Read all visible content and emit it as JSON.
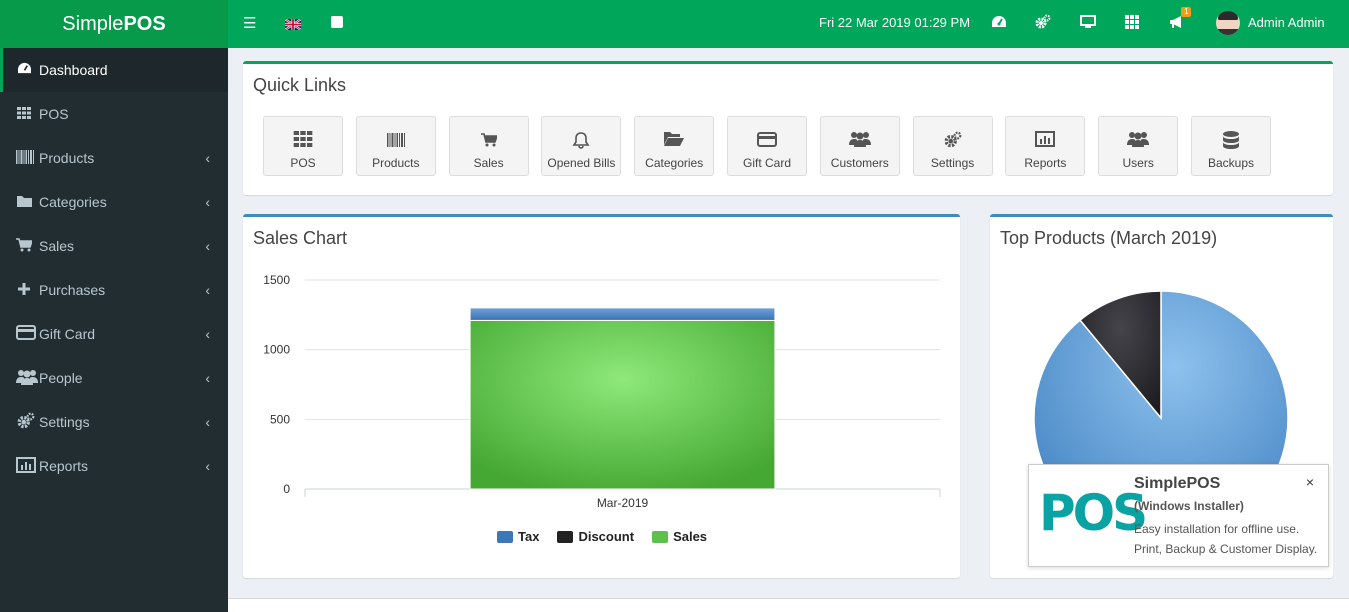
{
  "header": {
    "logo_light": "Simple",
    "logo_bold": "POS",
    "datetime": "Fri 22 Mar 2019 01:29 PM",
    "notification_count": "1",
    "user_name": "Admin Admin"
  },
  "sidebar": {
    "items": [
      {
        "label": "Dashboard",
        "icon": "dashboard-icon"
      },
      {
        "label": "POS",
        "icon": "grid-icon"
      },
      {
        "label": "Products",
        "icon": "barcode-icon"
      },
      {
        "label": "Categories",
        "icon": "folder-icon"
      },
      {
        "label": "Sales",
        "icon": "cart-icon"
      },
      {
        "label": "Purchases",
        "icon": "plus-icon"
      },
      {
        "label": "Gift Card",
        "icon": "credit-card-icon"
      },
      {
        "label": "People",
        "icon": "users-icon"
      },
      {
        "label": "Settings",
        "icon": "gears-icon"
      },
      {
        "label": "Reports",
        "icon": "bar-chart-icon"
      }
    ]
  },
  "quick_links": {
    "title": "Quick Links",
    "items": [
      {
        "label": "POS",
        "icon": "th-icon"
      },
      {
        "label": "Products",
        "icon": "barcode-icon"
      },
      {
        "label": "Sales",
        "icon": "cart-icon"
      },
      {
        "label": "Opened Bills",
        "icon": "bell-icon"
      },
      {
        "label": "Categories",
        "icon": "folder-open-icon"
      },
      {
        "label": "Gift Card",
        "icon": "credit-card-icon"
      },
      {
        "label": "Customers",
        "icon": "users-icon"
      },
      {
        "label": "Settings",
        "icon": "gears-icon"
      },
      {
        "label": "Reports",
        "icon": "bar-chart-icon"
      },
      {
        "label": "Users",
        "icon": "users-icon"
      },
      {
        "label": "Backups",
        "icon": "database-icon"
      }
    ]
  },
  "sales_chart_box": {
    "title": "Sales Chart"
  },
  "top_products_box": {
    "title": "Top Products (March 2019)"
  },
  "popup": {
    "title": "SimplePOS",
    "subtitle": "(Windows Installer)",
    "line1": "Easy installation for offline use.",
    "line2": "Print, Backup & Customer Display.",
    "logo_text": "POS",
    "close": "×"
  },
  "colors": {
    "brand_green": "#00a65a",
    "sidebar_bg": "#222d32",
    "tax": "#3c78b5",
    "discount": "#222222",
    "sales": "#5cc04a"
  },
  "chart_data": [
    {
      "type": "bar",
      "stacked": true,
      "title": "",
      "categories": [
        "Mar-2019"
      ],
      "series": [
        {
          "name": "Sales",
          "values": [
            1210
          ],
          "color": "#5cc04a"
        },
        {
          "name": "Discount",
          "values": [
            0
          ],
          "color": "#222222"
        },
        {
          "name": "Tax",
          "values": [
            90
          ],
          "color": "#3c78b5"
        }
      ],
      "legend_order": [
        "Tax",
        "Discount",
        "Sales"
      ],
      "yticks": [
        "1500",
        "1000",
        "500",
        "0"
      ],
      "ylim": [
        0,
        1500
      ],
      "grid": true,
      "legend_position": "bottom"
    },
    {
      "type": "pie",
      "title": "Top Products (March 2019)",
      "slices": [
        {
          "value": 89,
          "color": "#5b9bd5"
        },
        {
          "value": 11,
          "color": "#2a2a2e"
        }
      ]
    }
  ]
}
